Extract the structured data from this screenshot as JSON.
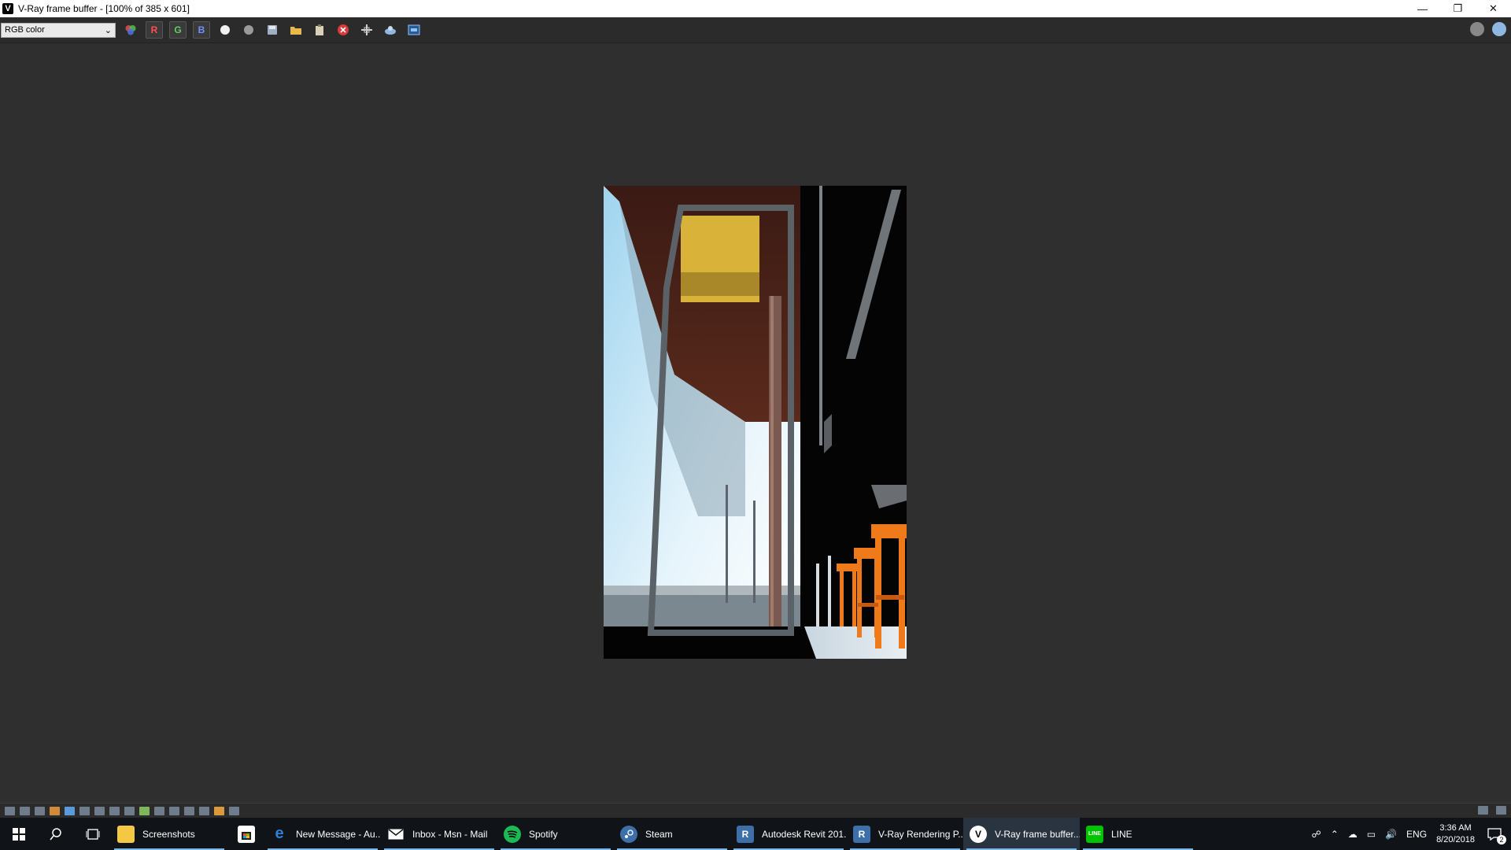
{
  "window": {
    "title": "V-Ray frame buffer - [100% of 385 x 601]",
    "minimize_glyph": "—",
    "restore_glyph": "❐",
    "close_glyph": "✕"
  },
  "toolbar": {
    "channel_select": {
      "value": "RGB color"
    },
    "channel_buttons": {
      "red": "R",
      "green": "G",
      "blue": "B"
    },
    "icons": [
      "color-corrections-icon",
      "red-channel-icon",
      "green-channel-icon",
      "blue-channel-icon",
      "alpha-channel-icon",
      "monochrome-icon",
      "save-icon",
      "load-icon",
      "clear-icon",
      "stop-icon",
      "region-render-icon",
      "render-last-icon",
      "vfb-settings-icon"
    ]
  },
  "render": {
    "width": 385,
    "height": 601,
    "colors": {
      "sky": "#cfe8f5",
      "ceiling": "#4a1e14",
      "wall": "#050505",
      "chairs": "#f07a1c",
      "panel": "#d9b23a"
    }
  },
  "taskbar": {
    "items": [
      {
        "label": "Screenshots",
        "icon": "folder-icon",
        "color": "#f4c842"
      },
      {
        "label": "",
        "icon": "store-icon",
        "color": "#ffffff"
      },
      {
        "label": "New Message - Au...",
        "icon": "edge-icon",
        "color": "#2e7fd8"
      },
      {
        "label": "Inbox - Msn - Mail",
        "icon": "mail-icon",
        "color": "#ffffff"
      },
      {
        "label": "Spotify",
        "icon": "spotify-icon",
        "color": "#1db954"
      },
      {
        "label": "Steam",
        "icon": "steam-icon",
        "color": "#3d6fa8"
      },
      {
        "label": "Autodesk Revit 201...",
        "icon": "revit-icon",
        "color": "#3d6fa8"
      },
      {
        "label": "V-Ray Rendering P...",
        "icon": "revit-icon",
        "color": "#3d6fa8"
      },
      {
        "label": "V-Ray frame buffer...",
        "icon": "vray-icon",
        "color": "#ffffff"
      },
      {
        "label": "LINE",
        "icon": "line-icon",
        "color": "#00c300"
      }
    ],
    "tray": {
      "language": "ENG",
      "time": "3:36 AM",
      "date": "8/20/2018",
      "notifications": "2"
    }
  }
}
